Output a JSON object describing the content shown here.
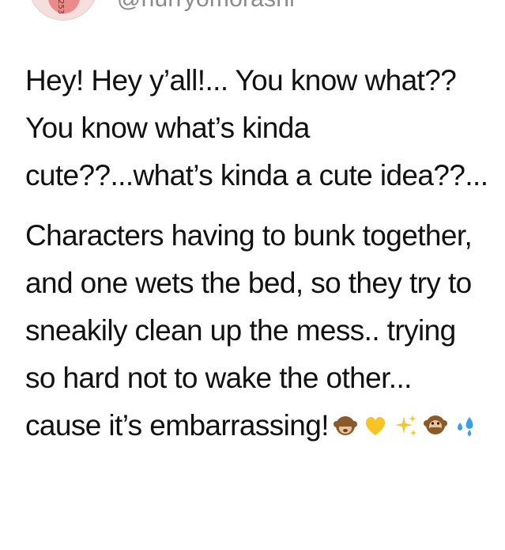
{
  "author": {
    "handle": "@hurryomorashi"
  },
  "tweet": {
    "paragraph_1": "Hey! Hey y’all!... You know what?? You know what’s kinda cute??...what’s kinda a cute idea??...",
    "paragraph_2": "Characters having to bunk together, and one wets the bed, so they try to sneakily clean up the mess.. trying so hard not to wake the other... cause it’s embarrassing!",
    "emojis": [
      "see-no-evil-monkey",
      "yellow-heart",
      "sparkles",
      "speak-no-evil-monkey",
      "sweat-droplets"
    ]
  },
  "colors": {
    "text": "#111111",
    "handle": "#8a8a8a",
    "heart": "#f7c325",
    "sparkle": "#f4c430",
    "droplet": "#3aa0e8",
    "monkey": "#8b5a2b"
  }
}
